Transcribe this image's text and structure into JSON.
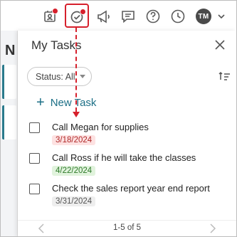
{
  "toolbar": {
    "icons": [
      "contact-card-icon",
      "task-check-icon",
      "megaphone-icon",
      "chat-icon",
      "help-icon",
      "clock-icon",
      "chevron-down-icon"
    ],
    "avatar_initials": "TM"
  },
  "background": {
    "partial_letter": "N"
  },
  "panel": {
    "title": "My Tasks",
    "status_filter": "Status: All",
    "new_task_label": "New Task",
    "new_task_plus": "+",
    "tasks": [
      {
        "title": "Call Megan for supplies",
        "date": "3/18/2024",
        "date_status": "overdue"
      },
      {
        "title": "Call Ross if he will take the classes",
        "date": "4/22/2024",
        "date_status": "upcoming"
      },
      {
        "title": "Check the sales report year end report",
        "date": "3/31/2024",
        "date_status": "neutral"
      }
    ],
    "pagination": "1-5 of 5"
  },
  "colors": {
    "accent": "#1c6f86",
    "annotation": "#d6202c",
    "overdue_bg": "#fde2e2",
    "overdue_text": "#b02a2a",
    "upcoming_bg": "#e1f3dd",
    "upcoming_text": "#2e7a2a",
    "neutral_bg": "#eeeeee",
    "neutral_text": "#555555"
  }
}
